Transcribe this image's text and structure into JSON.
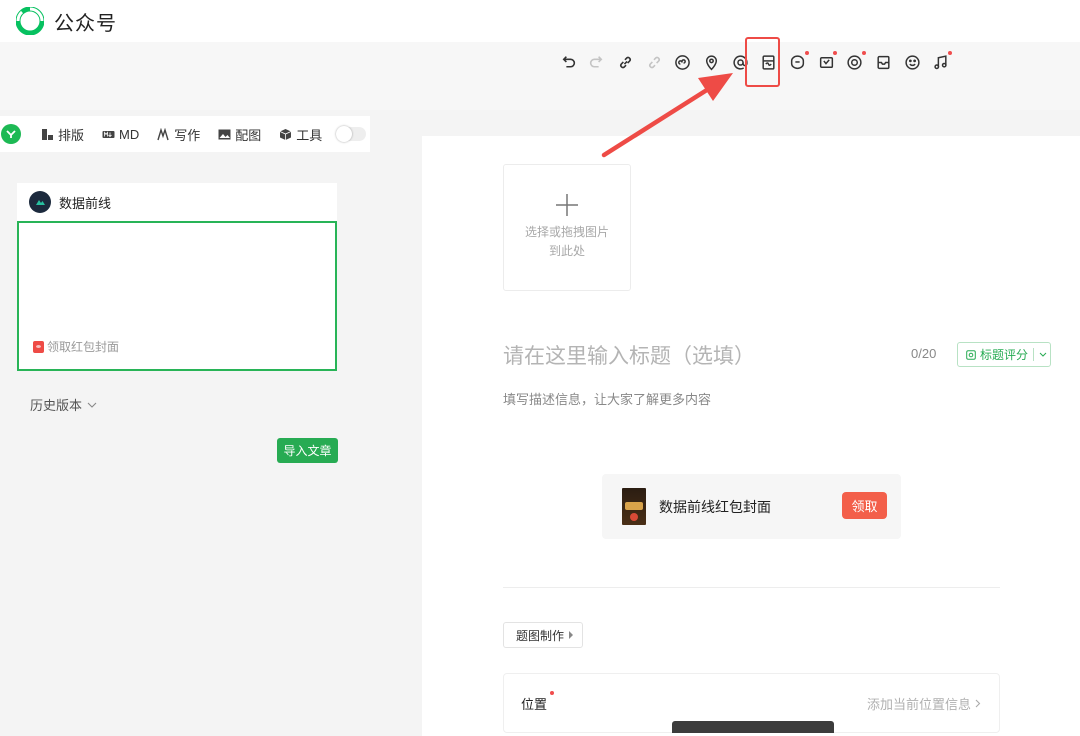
{
  "app": {
    "brand": "公众号",
    "accent": "#07c160"
  },
  "toolbar": {
    "icons": [
      "undo-icon",
      "redo-icon",
      "link-icon",
      "unlink-icon",
      "mini-program-icon",
      "location-icon",
      "mention-icon",
      "red-packet-cover-icon",
      "search-icon",
      "poll-icon",
      "audio-circle-icon",
      "coupon-icon",
      "emoji-icon",
      "music-icon"
    ],
    "highlight_color": "#ee4b46"
  },
  "plugin_bar": {
    "items": [
      {
        "label": "排版",
        "icon": "layout-icon"
      },
      {
        "label": "MD",
        "icon": "markdown-icon"
      },
      {
        "label": "写作",
        "icon": "pen-icon"
      },
      {
        "label": "配图",
        "icon": "image-icon"
      },
      {
        "label": "工具",
        "icon": "cube-icon"
      }
    ]
  },
  "preview": {
    "account_name": "数据前线",
    "cover_link": "领取红包封面"
  },
  "history_label": "历史版本",
  "import_button": "导入文章",
  "editor": {
    "upload_hint_1": "选择或拖拽图片",
    "upload_hint_2": "到此处",
    "title_placeholder": "请在这里输入标题（选填）",
    "title_count": "0/20",
    "score_button": "标题评分",
    "desc_placeholder": "填写描述信息，让大家了解更多内容",
    "cover_card": {
      "name": "数据前线红包封面",
      "claim": "领取"
    },
    "tutu_button": "题图制作",
    "location": {
      "label": "位置",
      "add": "添加当前位置信息"
    }
  }
}
